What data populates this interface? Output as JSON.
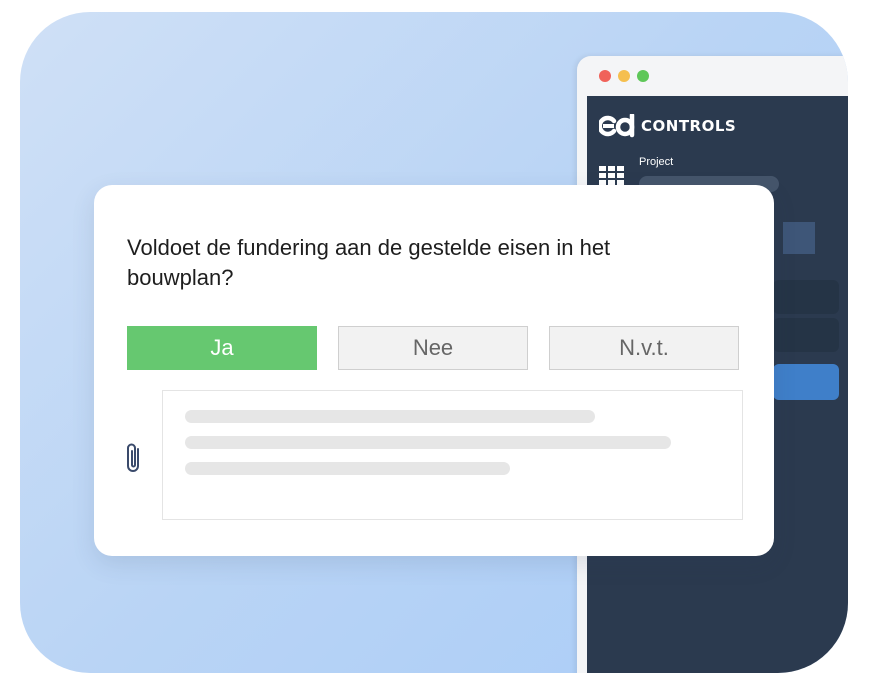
{
  "window": {
    "dot_colors": [
      "#f0625a",
      "#f5bf4f",
      "#5ec759"
    ]
  },
  "app": {
    "logo_mark": "ed",
    "logo_text": "CONTROLS",
    "project_label": "Project",
    "grid_icon": "grid-icon",
    "accent_color": "#3f7fc9"
  },
  "question": {
    "text": "Voldoet de fundering aan de gestelde eisen in het bouwplan?",
    "answers": [
      {
        "label": "Ja",
        "selected": true,
        "color": "#66c870"
      },
      {
        "label": "Nee",
        "selected": false
      },
      {
        "label": "N.v.t.",
        "selected": false
      }
    ],
    "attachment_icon": "paperclip-icon"
  }
}
